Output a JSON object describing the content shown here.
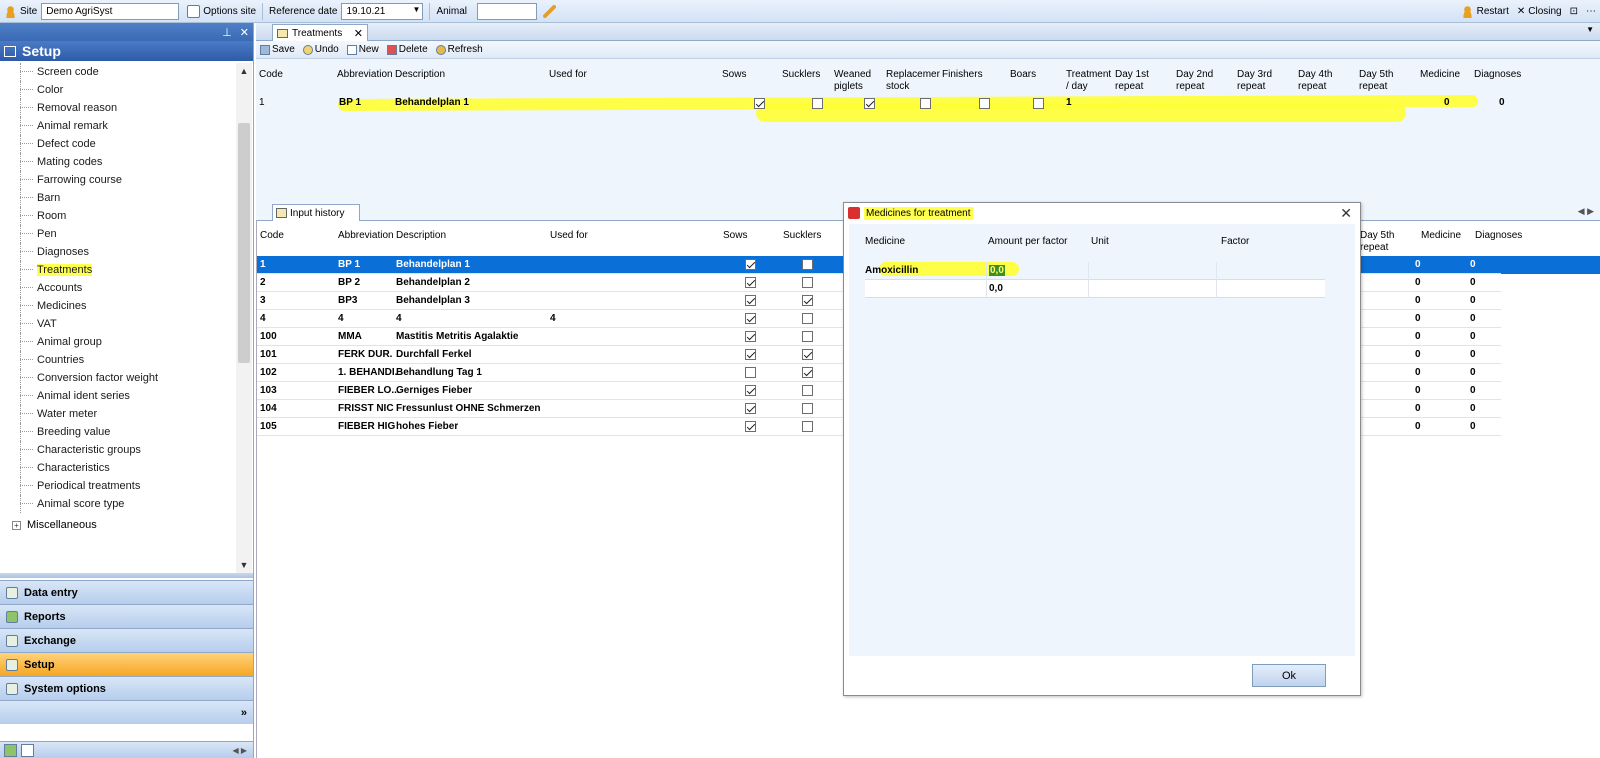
{
  "topbar": {
    "site_label": "Site",
    "site_value": "Demo AgriSyst",
    "options_site": "Options site",
    "reference_date_label": "Reference date",
    "reference_date_value": "19.10.21",
    "animal_label": "Animal",
    "animal_value": "",
    "restart": "Restart",
    "closing": "Closing"
  },
  "sidebar": {
    "title": "Setup",
    "items": [
      "Screen code",
      "Color",
      "Removal reason",
      "Animal remark",
      "Defect code",
      "Mating codes",
      "Farrowing course",
      "Barn",
      "Room",
      "Pen",
      "Diagnoses",
      "Treatments",
      "Accounts",
      "Medicines",
      "VAT",
      "Animal group",
      "Countries",
      "Conversion factor weight",
      "Animal ident series",
      "Water meter",
      "Breeding value",
      "Characteristic groups",
      "Characteristics",
      "Periodical treatments",
      "Animal score type"
    ],
    "misc": "Miscellaneous",
    "nav": [
      "Data entry",
      "Reports",
      "Exchange",
      "Setup",
      "System options"
    ]
  },
  "tab": {
    "label": "Treatments"
  },
  "toolbar": {
    "save": "Save",
    "undo": "Undo",
    "new": "New",
    "delete": "Delete",
    "refresh": "Refresh"
  },
  "top_grid": {
    "headers": {
      "code": "Code",
      "abbr": "Abbreviation",
      "desc": "Description",
      "used": "Used for",
      "sows": "Sows",
      "sucklers": "Sucklers",
      "weaned": "Weaned\npiglets",
      "replacement": "Replacemer\nstock",
      "finishers": "Finishers",
      "boars": "Boars",
      "tpd": "Treatment\n/ day",
      "d1": "Day 1st\nrepeat",
      "d2": "Day 2nd\nrepeat",
      "d3": "Day 3rd\nrepeat",
      "d4": "Day 4th\nrepeat",
      "d5": "Day 5th\nrepeat",
      "medicine": "Medicine",
      "diagnoses": "Diagnoses"
    },
    "row": {
      "code": "1",
      "abbr": "BP 1",
      "desc": "Behandelplan 1",
      "tpd": "1",
      "medicine": "0",
      "diagnoses": "0"
    }
  },
  "subtab": {
    "label": "Input history"
  },
  "bottom_grid": {
    "headers": {
      "code": "Code",
      "abbr": "Abbreviation",
      "desc": "Description",
      "used": "Used for",
      "sows": "Sows",
      "sucklers": "Sucklers",
      "d5": "Day 5th\nrepeat",
      "medicine": "Medicine",
      "diagnoses": "Diagnoses"
    },
    "rows": [
      {
        "code": "1",
        "abbr": "BP 1",
        "desc": "Behandelplan 1",
        "used": "",
        "sows": true,
        "sucklers": false,
        "medicine": "0",
        "diagnoses": "0"
      },
      {
        "code": "2",
        "abbr": "BP 2",
        "desc": "Behandelplan 2",
        "used": "",
        "sows": true,
        "sucklers": false,
        "medicine": "0",
        "diagnoses": "0"
      },
      {
        "code": "3",
        "abbr": "BP3",
        "desc": "Behandelplan 3",
        "used": "",
        "sows": true,
        "sucklers": true,
        "medicine": "0",
        "diagnoses": "0"
      },
      {
        "code": "4",
        "abbr": "4",
        "desc": "4",
        "used": "4",
        "sows": true,
        "sucklers": false,
        "medicine": "0",
        "diagnoses": "0"
      },
      {
        "code": "100",
        "abbr": "MMA",
        "desc": "Mastitis Metritis Agalaktie",
        "used": "",
        "sows": true,
        "sucklers": false,
        "medicine": "0",
        "diagnoses": "0"
      },
      {
        "code": "101",
        "abbr": "FERK DUR.",
        "desc": "Durchfall Ferkel",
        "used": "",
        "sows": true,
        "sucklers": true,
        "medicine": "0",
        "diagnoses": "0"
      },
      {
        "code": "102",
        "abbr": "1. BEHANDI.",
        "desc": "Behandlung Tag 1",
        "used": "",
        "sows": false,
        "sucklers": true,
        "medicine": "0",
        "diagnoses": "0"
      },
      {
        "code": "103",
        "abbr": "FIEBER LO...",
        "desc": "Gerniges Fieber",
        "used": "",
        "sows": true,
        "sucklers": false,
        "medicine": "0",
        "diagnoses": "0"
      },
      {
        "code": "104",
        "abbr": "FRISST NIC",
        "desc": "Fressunlust OHNE Schmerzen",
        "used": "",
        "sows": true,
        "sucklers": false,
        "medicine": "0",
        "diagnoses": "0"
      },
      {
        "code": "105",
        "abbr": "FIEBER HIG",
        "desc": "hohes Fieber",
        "used": "",
        "sows": true,
        "sucklers": false,
        "medicine": "0",
        "diagnoses": "0"
      }
    ]
  },
  "dialog": {
    "title": "Medicines for treatment",
    "headers": {
      "medicine": "Medicine",
      "amount": "Amount per factor",
      "unit": "Unit",
      "factor": "Factor"
    },
    "rows": [
      {
        "medicine": "Amoxicillin",
        "amount": "0,0"
      },
      {
        "medicine": "",
        "amount": "0,0"
      }
    ],
    "ok": "Ok"
  }
}
